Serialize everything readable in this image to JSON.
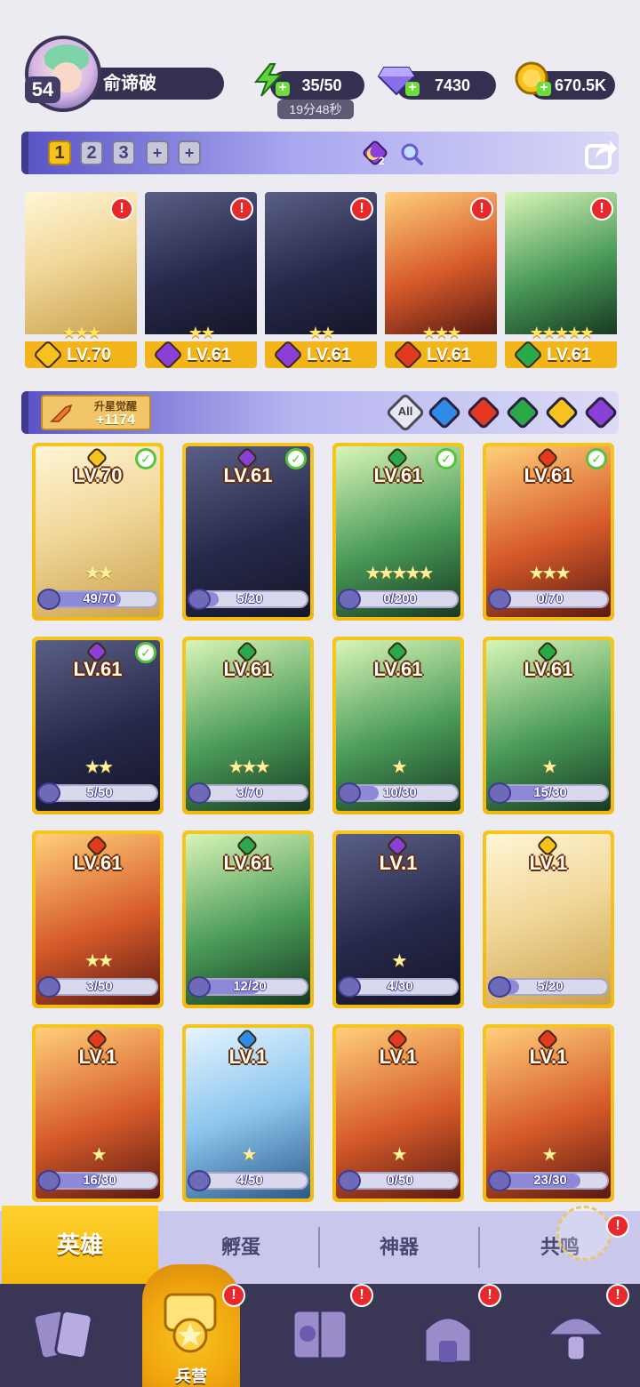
{
  "player": {
    "level": "54",
    "name": "俞谛破"
  },
  "resources": {
    "energy": {
      "icon": "lightning-icon",
      "value": "35/50",
      "timer": "19分48秒"
    },
    "gems": {
      "icon": "diamond-icon",
      "value": "7430"
    },
    "gold": {
      "icon": "gold-coin-icon",
      "value": "670.5K"
    }
  },
  "team_tabs": [
    "1",
    "2",
    "3",
    "+",
    "+"
  ],
  "team_buff": {
    "count": "2"
  },
  "lineup": [
    {
      "level": "LV.70",
      "element": "light",
      "stars": "★★★",
      "alert": "!"
    },
    {
      "level": "LV.61",
      "element": "dark",
      "stars": "★★",
      "alert": "!"
    },
    {
      "level": "LV.61",
      "element": "dark",
      "stars": "★★",
      "alert": "!"
    },
    {
      "level": "LV.61",
      "element": "fire",
      "stars": "★★★",
      "alert": "!"
    },
    {
      "level": "LV.61",
      "element": "nature",
      "stars": "★★★★★",
      "alert": "!"
    }
  ],
  "awaken": {
    "title": "升星觉醒",
    "value": "+1174"
  },
  "filters": {
    "all": "All",
    "items": [
      "water",
      "fire",
      "nature",
      "light",
      "dark"
    ]
  },
  "heroes": [
    {
      "level": "LV.70",
      "element": "light",
      "checked": true,
      "stars": "★★",
      "shards": "49/70",
      "progress": 0.7
    },
    {
      "level": "LV.61",
      "element": "dark",
      "checked": true,
      "stars": "",
      "shards": "5/20",
      "progress": 0.25
    },
    {
      "level": "LV.61",
      "element": "nature",
      "checked": true,
      "stars": "★★★★★",
      "shards": "0/200",
      "progress": 0.0
    },
    {
      "level": "LV.61",
      "element": "fire",
      "checked": true,
      "stars": "★★★",
      "shards": "0/70",
      "progress": 0.0
    },
    {
      "level": "LV.61",
      "element": "dark",
      "checked": true,
      "stars": "★★",
      "shards": "5/50",
      "progress": 0.1
    },
    {
      "level": "LV.61",
      "element": "nature",
      "checked": false,
      "stars": "★★★",
      "shards": "3/70",
      "progress": 0.04
    },
    {
      "level": "LV.61",
      "element": "nature",
      "checked": false,
      "stars": "★",
      "shards": "10/30",
      "progress": 0.33
    },
    {
      "level": "LV.61",
      "element": "nature",
      "checked": false,
      "stars": "★",
      "shards": "15/30",
      "progress": 0.5
    },
    {
      "level": "LV.61",
      "element": "fire",
      "checked": false,
      "stars": "★★",
      "shards": "3/50",
      "progress": 0.06
    },
    {
      "level": "LV.61",
      "element": "nature",
      "checked": false,
      "stars": "",
      "shards": "12/20",
      "progress": 0.6
    },
    {
      "level": "LV.1",
      "element": "dark",
      "checked": false,
      "stars": "★",
      "shards": "4/30",
      "progress": 0.13
    },
    {
      "level": "LV.1",
      "element": "light",
      "checked": false,
      "stars": "",
      "shards": "5/20",
      "progress": 0.25
    },
    {
      "level": "LV.1",
      "element": "fire",
      "checked": false,
      "stars": "★",
      "shards": "16/30",
      "progress": 0.53
    },
    {
      "level": "LV.1",
      "element": "water",
      "checked": false,
      "stars": "★",
      "shards": "4/50",
      "progress": 0.08
    },
    {
      "level": "LV.1",
      "element": "fire",
      "checked": false,
      "stars": "★",
      "shards": "0/50",
      "progress": 0.0
    },
    {
      "level": "LV.1",
      "element": "fire",
      "checked": false,
      "stars": "★",
      "shards": "23/30",
      "progress": 0.77
    }
  ],
  "subtabs": [
    "英雄",
    "孵蛋",
    "神器",
    "共鸣"
  ],
  "nav": [
    {
      "icon": "cards-icon",
      "label": "",
      "alert": ""
    },
    {
      "icon": "barracks-icon",
      "label": "兵营",
      "alert": "!"
    },
    {
      "icon": "map-book-icon",
      "label": "",
      "alert": "!"
    },
    {
      "icon": "shrine-icon",
      "label": "",
      "alert": "!"
    },
    {
      "icon": "mushroom-icon",
      "label": "",
      "alert": "!"
    }
  ],
  "colors": {
    "light": "#f6c21e",
    "dark": "#8a3fd6",
    "fire": "#e23a1e",
    "nature": "#2aa94a",
    "water": "#2f8be6",
    "gold_band": "#f2b418",
    "bar_bg": "#35304f"
  }
}
